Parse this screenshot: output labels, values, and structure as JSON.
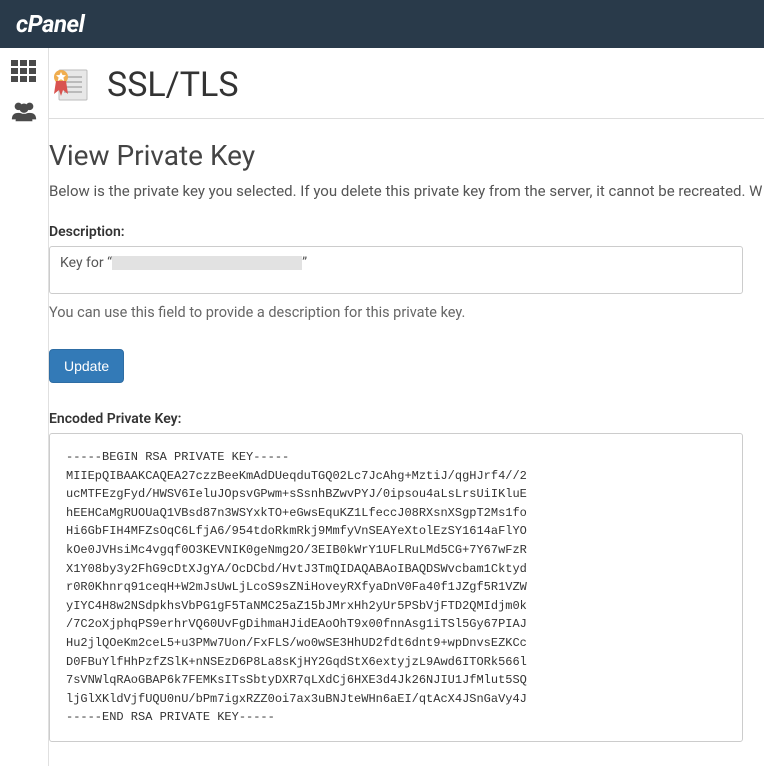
{
  "brand": "cPanel",
  "page": {
    "title": "SSL/TLS",
    "section_title": "View Private Key",
    "lead": "Below is the private key you selected. If you delete this private key from the server, it cannot be recreated. W"
  },
  "description": {
    "label": "Description:",
    "value_prefix": "Key for “",
    "value_suffix": "”",
    "help": "You can use this field to provide a description for this private key."
  },
  "buttons": {
    "update": "Update"
  },
  "encoded": {
    "label": "Encoded Private Key:",
    "text": "-----BEGIN RSA PRIVATE KEY-----\nMIIEpQIBAAKCAQEA27czzBeeKmAdDUeqduTGQ02Lc7JcAhg+MztiJ/qgHJrf4//2\nucMTFEzgFyd/HWSV6IeluJOpsvGPwm+sSsnhBZwvPYJ/0ipsou4aLsLrsUiIKluE\nhEEHCaMgRUOUaQ1VBsd87n3WSYxkTO+eGwsEquKZ1LfeccJ08RXsnXSgpT2Ms1fo\nHi6GbFIH4MFZsOqC6LfjA6/954tdoRkmRkj9MmfyVnSEAYeXtolEzSY1614aFlYO\nkOe0JVHsiMc4vgqf0O3KEVNIK0geNmg2O/3EIB0kWrY1UFLRuLMd5CG+7Y67wFzR\nX1Y08by3y2FhG9cDtXJgYA/OcDCbd/HvtJ3TmQIDAQABAoIBAQDSWvcbam1Cktyd\nr0R0Khnrq91ceqH+W2mJsUwLjLcoS9sZNiHoveyRXfyaDnV0Fa40f1JZgf5R1VZW\nyIYC4H8w2NSdpkhsVbPG1gF5TaNMC25aZ15bJMrxHh2yUr5PSbVjFTD2QMIdjm0k\n/7C2oXjphqPS9erhrVQ60UvFgDihmaHJidEAoOhT9x00fnnAsg1iTSl5Gy67PIAJ\nHu2jlQOeKm2ceL5+u3PMw7Uon/FxFLS/wo0wSE3HhUD2fdt6dnt9+wpDnvsEZKCc\nD0FBuYlfHhPzfZSlK+nNSEzD6P8La8sKjHY2GqdStX6extyjzL9Awd6ITORk566l\n7sVNWlqRAoGBAP6k7FEMKsITsSbtyDXR7qLXdCj6HXE3d4Jk26NJIU1JfMlut5SQ\nljGlXKldVjfUQU0nU/bPm7igxRZZ0oi7ax3uBNJteWHn6aEI/qtAcX4JSnGaVy4J\n-----END RSA PRIVATE KEY-----"
  }
}
